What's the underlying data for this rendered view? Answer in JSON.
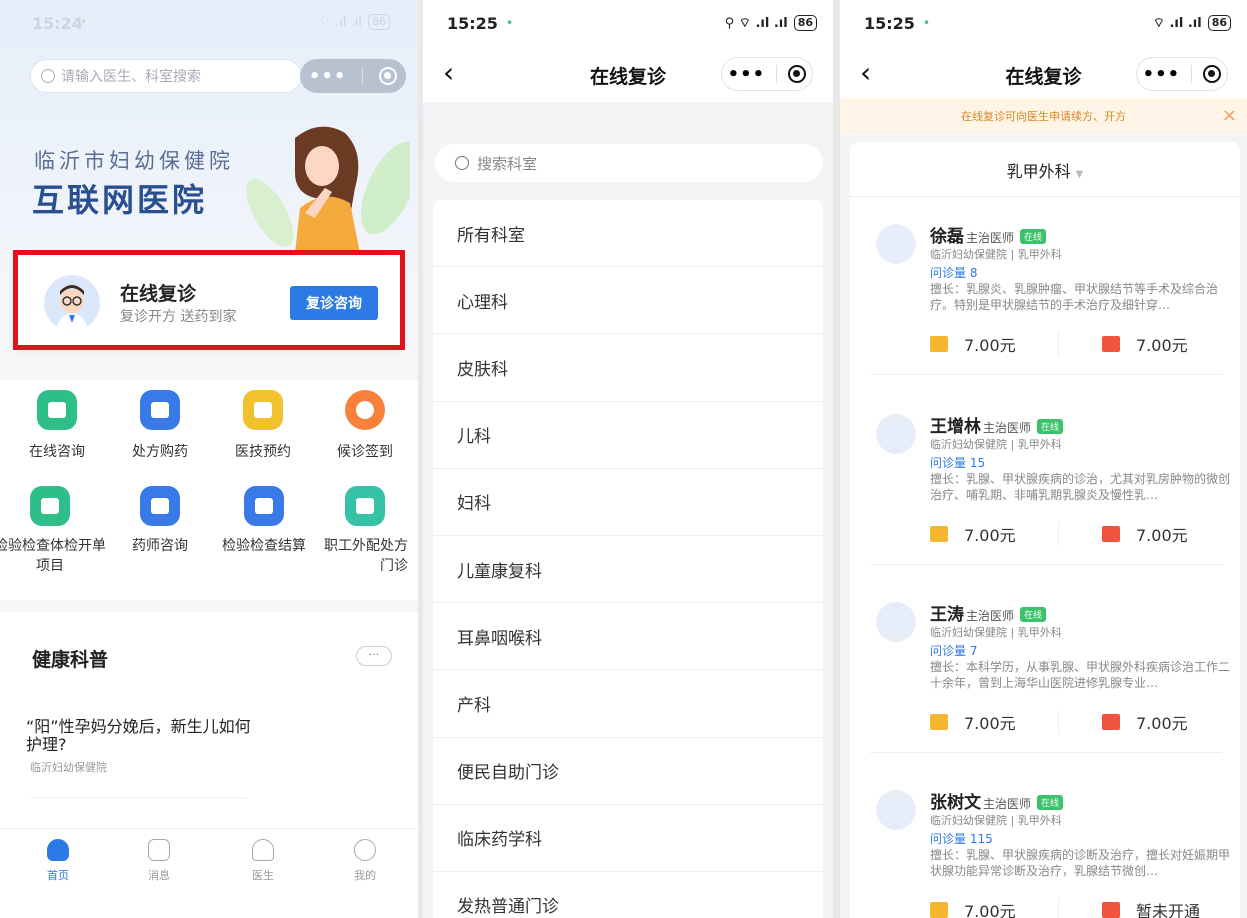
{
  "status_bars": [
    {
      "time": "15:24",
      "battery": "86"
    },
    {
      "time": "15:25",
      "battery": "86"
    },
    {
      "time": "15:25",
      "battery": "86"
    }
  ],
  "home": {
    "search_placeholder": "请输入医生、科室搜索",
    "hospital_name": "临沂市妇幼保健院",
    "hospital_tagline": "互联网医院",
    "feature_card": {
      "title": "在线复诊",
      "subtitle": "复诊开方 送药到家",
      "button": "复诊咨询"
    },
    "services": [
      {
        "label": "在线咨询",
        "color": "#2fbe8a",
        "icon": "chat-icon"
      },
      {
        "label": "处方购药",
        "color": "#3a7ae8",
        "icon": "prescription-icon"
      },
      {
        "label": "医技预约",
        "color": "#f2c12e",
        "icon": "calendar-icon"
      },
      {
        "label": "候诊签到",
        "color": "#f7803a",
        "icon": "clock-icon"
      },
      {
        "label": "检验检查体检开单项目",
        "color": "#2fbe8a",
        "icon": "clipboard-icon"
      },
      {
        "label": "药师咨询",
        "color": "#3a7ae8",
        "icon": "pharmacist-icon"
      },
      {
        "label": "检验检查结算",
        "color": "#3a7ae8",
        "icon": "invoice-icon"
      },
      {
        "label": "职工外配处方门诊",
        "color": "#35c2a6",
        "icon": "medicine-bottle-icon"
      }
    ],
    "section_title": "健康科普",
    "section_more": "···",
    "article": {
      "title": "“阳”性孕妈分娩后，新生儿如何护理?",
      "source": "临沂妇幼保健院"
    },
    "tabs": [
      {
        "label": "首页",
        "icon": "home-icon"
      },
      {
        "label": "消息",
        "icon": "message-icon"
      },
      {
        "label": "医生",
        "icon": "doctor-icon"
      },
      {
        "label": "我的",
        "icon": "profile-icon"
      }
    ]
  },
  "departments_page": {
    "title": "在线复诊",
    "search_placeholder": "搜索科室",
    "departments": [
      "所有科室",
      "心理科",
      "皮肤科",
      "儿科",
      "妇科",
      "儿童康复科",
      "耳鼻咽喉科",
      "产科",
      "便民自助门诊",
      "临床药学科",
      "发热普通门诊"
    ]
  },
  "doctors_page": {
    "title": "在线复诊",
    "notice": "在线复诊可向医生申请续方、开方",
    "notice_close": "×",
    "selected_department": "乳甲外科",
    "online_badge": "在线",
    "doctors": [
      {
        "name": "徐磊",
        "rank": "主治医师",
        "hospital": "临沂妇幼保健院 | 乳甲外科",
        "consults": "问诊量 8",
        "expertise": "擅长：乳腺炎、乳腺肿瘤、甲状腺结节等手术及综合治疗。特别是甲状腺结节的手术治疗及细针穿…",
        "image_price": "7.00元",
        "video_price": "7.00元"
      },
      {
        "name": "王增林",
        "rank": "主治医师",
        "hospital": "临沂妇幼保健院 | 乳甲外科",
        "consults": "问诊量 15",
        "expertise": "擅长：乳腺、甲状腺疾病的诊治，尤其对乳房肿物的微创治疗、哺乳期、非哺乳期乳腺炎及慢性乳…",
        "image_price": "7.00元",
        "video_price": "7.00元"
      },
      {
        "name": "王涛",
        "rank": "主治医师",
        "hospital": "临沂妇幼保健院 | 乳甲外科",
        "consults": "问诊量 7",
        "expertise": "擅长：本科学历，从事乳腺、甲状腺外科疾病诊治工作二十余年，曾到上海华山医院进修乳腺专业…",
        "image_price": "7.00元",
        "video_price": "7.00元"
      },
      {
        "name": "张树文",
        "rank": "主治医师",
        "hospital": "临沂妇幼保健院 | 乳甲外科",
        "consults": "问诊量 115",
        "expertise": "擅长：乳腺、甲状腺疾病的诊断及治疗，擅长对妊娠期甲状腺功能异常诊断及治疗，乳腺结节微创…",
        "image_price": "7.00元",
        "video_price": "暂未开通"
      }
    ],
    "colors": {
      "image_consult": "#f5b630",
      "video_consult": "#f0533e",
      "accent": "#2b7ae5",
      "online": "#3cc26a"
    }
  }
}
